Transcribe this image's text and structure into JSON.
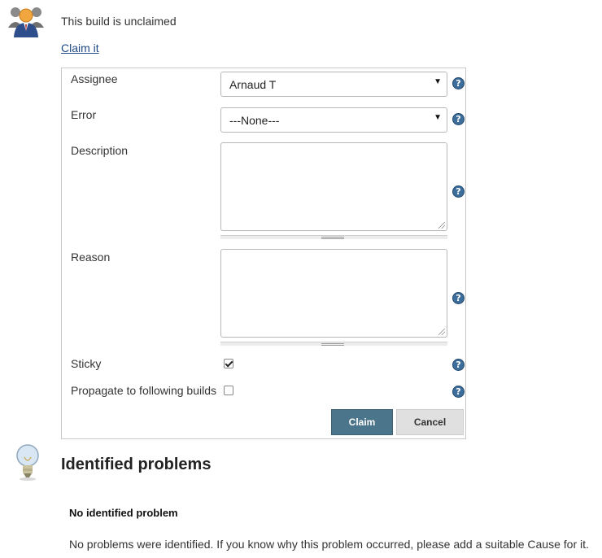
{
  "claim": {
    "status_text": "This build is unclaimed",
    "claim_link": "Claim it"
  },
  "form": {
    "assignee_label": "Assignee",
    "assignee_value": "Arnaud T",
    "error_label": "Error",
    "error_value": "---None---",
    "description_label": "Description",
    "description_value": "",
    "reason_label": "Reason",
    "reason_value": "",
    "sticky_label": "Sticky",
    "sticky_checked": true,
    "propagate_label": "Propagate to following builds",
    "propagate_checked": false,
    "claim_button": "Claim",
    "cancel_button": "Cancel",
    "help_glyph": "?"
  },
  "problems": {
    "heading": "Identified problems",
    "none_title": "No identified problem",
    "none_description": "No problems were identified. If you know why this problem occurred, please add a suitable Cause for it."
  },
  "icons": {
    "claim_icon": "users-icon",
    "problems_icon": "lightbulb-icon",
    "help_icon": "help-icon"
  },
  "colors": {
    "claim_button_bg": "#4b758b",
    "help_icon_bg": "#3c6d9b",
    "link": "#204a87"
  }
}
